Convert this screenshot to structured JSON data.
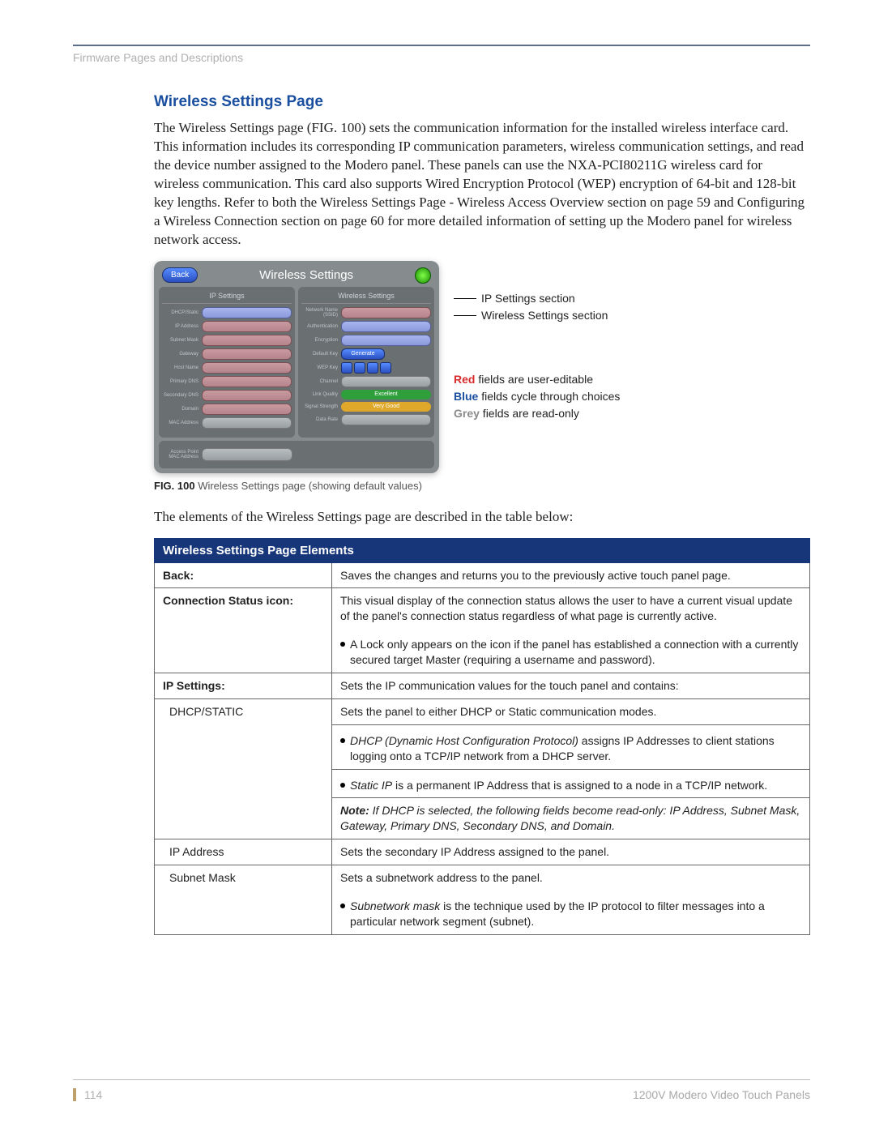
{
  "header": {
    "breadcrumb": "Firmware Pages and Descriptions"
  },
  "section": {
    "title": "Wireless Settings Page",
    "para": "The Wireless Settings page (FIG. 100) sets the communication information for the installed wireless interface card. This information includes its corresponding IP communication parameters, wireless communication settings, and read the device number assigned to the Modero panel. These panels can use the NXA-PCI80211G wireless card for wireless communication. This card also supports Wired Encryption Protocol (WEP) encryption of 64-bit and 128-bit key lengths. Refer to both the Wireless Settings Page - Wireless Access Overview section on page 59 and Configuring a Wireless Connection section on page 60 for more detailed information of setting up the Modero panel for wireless network access."
  },
  "figure": {
    "back_label": "Back",
    "title": "Wireless Settings",
    "col_left_header": "IP Settings",
    "col_right_header": "Wireless Settings",
    "left_labels": [
      "DHCP/Static",
      "IP Address",
      "Subnet Mask",
      "Gateway",
      "Host Name",
      "Primary DNS",
      "Secondary DNS",
      "Domain",
      "MAC Address"
    ],
    "right_labels": [
      "Network Name (SSID)",
      "Authentication",
      "Encryption",
      "Default Key",
      "WEP Key",
      "Channel",
      "Link Quality",
      "Signal Strength",
      "Data Rate"
    ],
    "generate_label": "Generate",
    "quality_value": "Excellent",
    "strength_value": "Very Good",
    "footer_label": "Access Point MAC Address",
    "callout1": "IP Settings section",
    "callout2": "Wireless Settings section",
    "legend_red_word": "Red",
    "legend_red_rest": " fields are user-editable",
    "legend_blue_word": "Blue",
    "legend_blue_rest": " fields cycle through choices",
    "legend_grey_word": "Grey",
    "legend_grey_rest": " fields are read-only",
    "caption_bold": "FIG. 100",
    "caption_rest": "  Wireless Settings page (showing default values)"
  },
  "table_intro": "The elements of the Wireless Settings page are described in the table below:",
  "table": {
    "title": "Wireless Settings Page Elements",
    "rows": {
      "back": {
        "label": "Back:",
        "desc": "Saves the changes and returns you to the previously active touch panel page."
      },
      "conn": {
        "label": "Connection Status icon:",
        "desc": "This visual display of the connection status allows the user to have a current visual update of the panel's connection status regardless of what page is currently active.",
        "bullet": "A Lock only appears on the icon if the panel has established a connection with a currently secured target Master (requiring a username and password)."
      },
      "ip": {
        "label": "IP Settings:",
        "desc": "Sets the IP communication values for the touch panel and contains:"
      },
      "dhcp": {
        "label": "DHCP/STATIC",
        "desc": "Sets the panel to either DHCP or Static communication modes.",
        "b1_em": "DHCP (Dynamic Host Configuration Protocol)",
        "b1_rest": " assigns IP Addresses to client stations logging onto a TCP/IP network from a DHCP server.",
        "b2_em": "Static IP",
        "b2_rest": " is a permanent IP Address that is assigned to a node in a TCP/IP network.",
        "note_bold": "Note:",
        "note_rest": " If DHCP is selected, the following fields become read-only: IP Address, Subnet Mask, Gateway, Primary DNS, Secondary DNS, and Domain."
      },
      "ipaddr": {
        "label": "IP Address",
        "desc": "Sets the secondary IP Address assigned to the panel."
      },
      "subnet": {
        "label": "Subnet Mask",
        "desc": "Sets a subnetwork address to the panel.",
        "b_em": "Subnetwork mask",
        "b_rest": " is the technique used by the IP protocol to filter messages into a particular network segment (subnet)."
      }
    }
  },
  "footer": {
    "page_num": "114",
    "doc_title": "1200V Modero Video Touch Panels"
  }
}
